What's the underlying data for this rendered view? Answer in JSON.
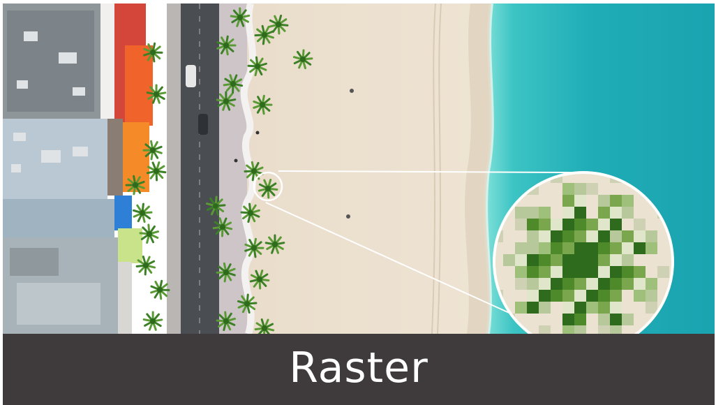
{
  "caption": "Raster",
  "colors": {
    "sand": "#ede2cf",
    "ocean": "#23b3bd",
    "ocean_shallow": "#4fd0cc",
    "road": "#46494d",
    "promenade": "#cfc7c9",
    "palm": "#3f8a2a",
    "caption_bar": "#3f3b3d",
    "caption_text": "#ffffff"
  },
  "zoom_pixel_palette": [
    "#c8d9b0",
    "#9fc07a",
    "#7aa64d",
    "#4f8a2a",
    "#2f6b1c",
    "#dfe6c9",
    "#b7c99a",
    "#6e9a3e",
    "#3a7a22",
    "#cfd1b5",
    "#a8b56c"
  ]
}
